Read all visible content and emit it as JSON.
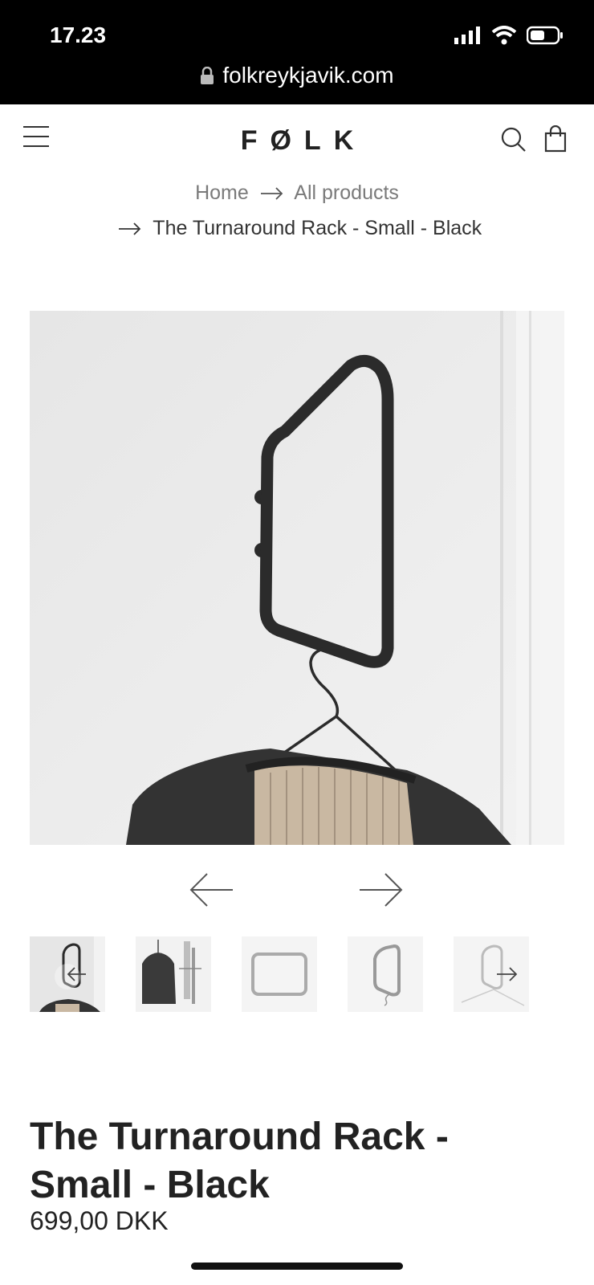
{
  "status_bar": {
    "time": "17.23",
    "url": "folkreykjavik.com",
    "icons": [
      "signal-icon",
      "wifi-icon",
      "battery-icon",
      "lock-icon"
    ]
  },
  "nav": {
    "logo": "FØLK",
    "icons": [
      "menu-icon",
      "search-icon",
      "shopping-bag-icon"
    ]
  },
  "breadcrumb": {
    "home": "Home",
    "all_products": "All products",
    "current": "The Turnaround Rack - Small - Black"
  },
  "gallery": {
    "main_image_alt": "The Turnaround Rack - Small - Black",
    "thumbnail_count": 5,
    "icons": [
      "arrow-left-icon",
      "arrow-right-icon"
    ]
  },
  "product": {
    "title_line1": "The Turnaround Rack -",
    "title_line2": "Small - Black",
    "price": "699,00 DKK"
  },
  "colors": {
    "status_bar_bg": "#000000",
    "text_dark": "#222222",
    "text_muted": "#7a7a7a",
    "rack_black": "#2b2b2b"
  }
}
